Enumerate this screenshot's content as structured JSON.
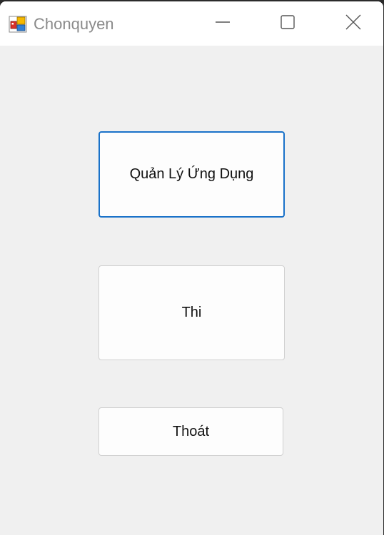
{
  "window": {
    "title": "Chonquyen",
    "icon": "winforms-app-icon",
    "controls": {
      "minimize": "minimize-icon",
      "maximize": "maximize-icon",
      "close": "close-icon"
    }
  },
  "form": {
    "buttons": [
      {
        "label": "Quản Lý Ứng Dụng",
        "focused": true
      },
      {
        "label": "Thi",
        "focused": false
      },
      {
        "label": "Thoát",
        "focused": false
      }
    ]
  },
  "colors": {
    "focus_border": "#1a72c9",
    "form_background": "#f0f0f0",
    "titlebar_background": "#ffffff"
  }
}
